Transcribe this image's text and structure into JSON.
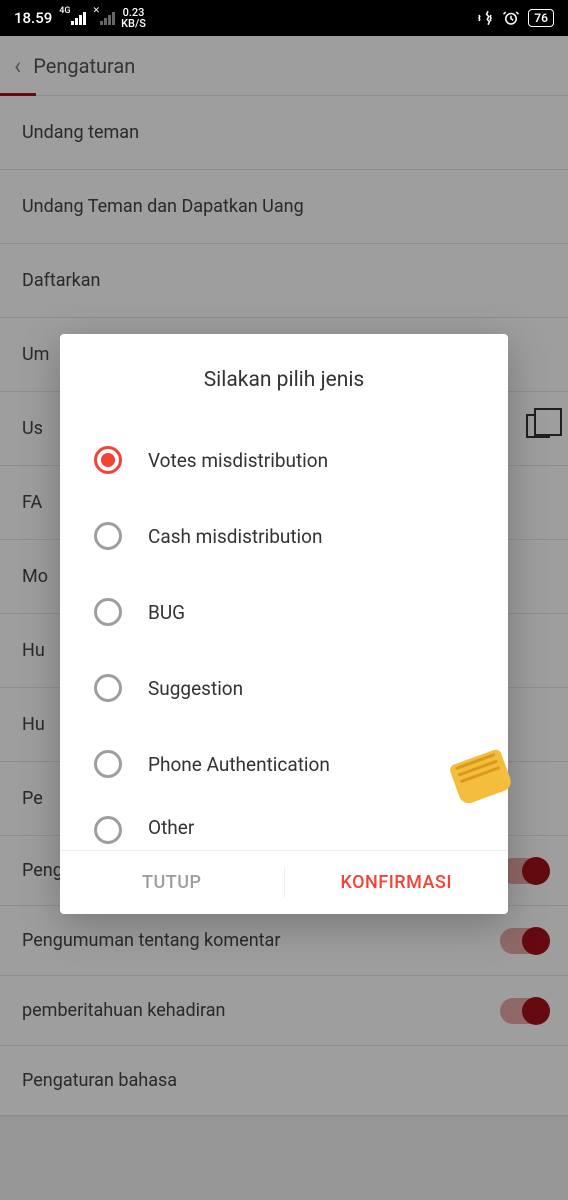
{
  "status_bar": {
    "time": "18.59",
    "net_indicator": "4G",
    "no_sim_x": "✕",
    "data_rate_value": "0.23",
    "data_rate_unit": "KB/S",
    "battery_percent": "76"
  },
  "header": {
    "back_icon": "‹",
    "title": "Pengaturan"
  },
  "settings_items": [
    {
      "label": "Undang teman"
    },
    {
      "label": "Undang Teman dan Dapatkan Uang"
    },
    {
      "label": "Daftarkan"
    },
    {
      "label": "Umpan balik",
      "truncated": "Um"
    },
    {
      "label": "User ID",
      "truncated": "Us",
      "has_copy": true
    },
    {
      "label": "FAQ",
      "truncated": "FA"
    },
    {
      "label": "Mode",
      "truncated": "Mo"
    },
    {
      "label": "Hubungi",
      "truncated": "Hu"
    },
    {
      "label": "Hubungi",
      "truncated": "Hu"
    },
    {
      "label": "Pengaturan",
      "truncated": "Pe"
    },
    {
      "label": "Pengumuman tentang Like",
      "toggle": true
    },
    {
      "label": "Pengumuman tentang komentar",
      "toggle": true
    },
    {
      "label": "pemberitahuan kehadiran",
      "toggle": true
    },
    {
      "label": "Pengaturan bahasa"
    }
  ],
  "dialog": {
    "title": "Silakan pilih jenis",
    "options": [
      {
        "label": "Votes misdistribution",
        "selected": true
      },
      {
        "label": "Cash misdistribution",
        "selected": false
      },
      {
        "label": "BUG",
        "selected": false
      },
      {
        "label": "Suggestion",
        "selected": false
      },
      {
        "label": "Phone Authentication",
        "selected": false
      },
      {
        "label": "Other",
        "selected": false,
        "cut": true
      }
    ],
    "close_label": "TUTUP",
    "confirm_label": "KONFIRMASI"
  },
  "annotation": {
    "hand_points_to": "Phone Authentication"
  }
}
